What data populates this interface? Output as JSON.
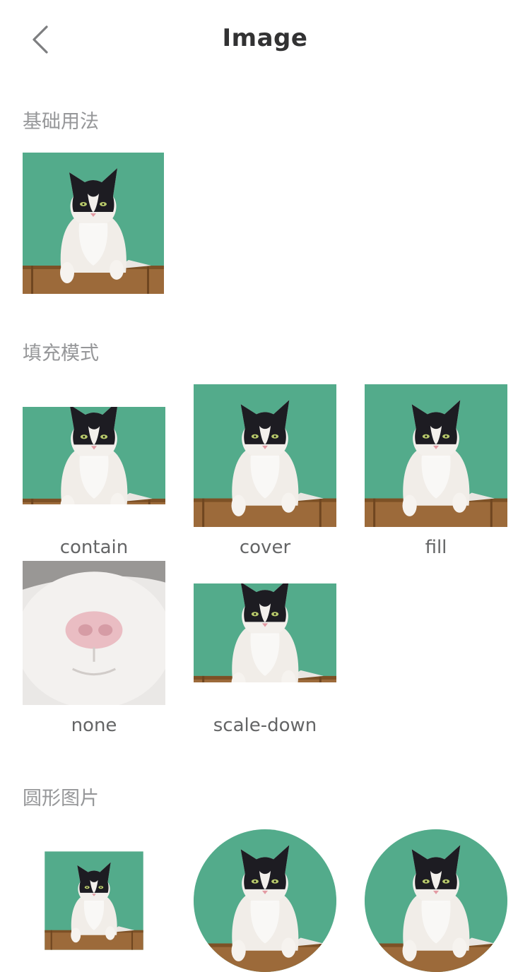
{
  "nav": {
    "title": "Image"
  },
  "sections": {
    "basic": {
      "title": "基础用法"
    },
    "fit": {
      "title": "填充模式",
      "items": [
        {
          "label": "contain"
        },
        {
          "label": "cover"
        },
        {
          "label": "fill"
        },
        {
          "label": "none"
        },
        {
          "label": "scale-down"
        }
      ]
    },
    "round": {
      "title": "圆形图片"
    }
  },
  "colors": {
    "background_green": "#4fa887",
    "wood": "#9c6a3a"
  }
}
